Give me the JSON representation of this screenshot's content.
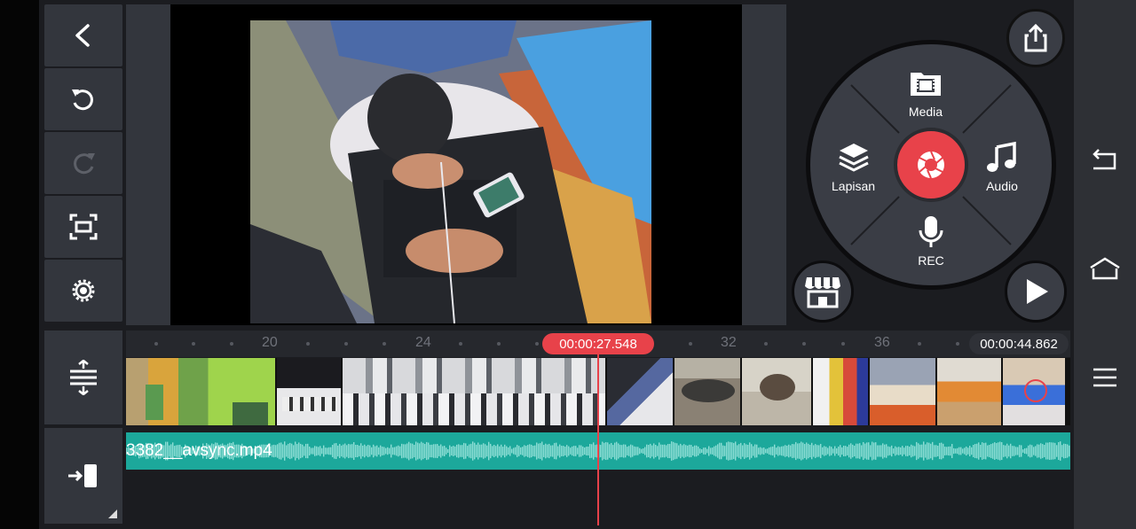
{
  "toolbar": {
    "back_icon": "chevron-left-icon",
    "undo_icon": "undo-icon",
    "redo_icon": "redo-icon",
    "capture_icon": "capture-frame-icon",
    "settings_icon": "gear-icon"
  },
  "wheel": {
    "media_label": "Media",
    "layer_label": "Lapisan",
    "audio_label": "Audio",
    "rec_label": "REC",
    "center_icon": "camera-shutter-icon"
  },
  "timeline": {
    "current_time": "00:00:27.548",
    "total_time": "00:00:44.862",
    "ruler_marks": [
      "20",
      "24",
      "32",
      "36"
    ],
    "audio_file": "3382__avsync.mp4"
  },
  "colors": {
    "accent": "#e8424a",
    "audio_track": "#1ca89b",
    "panel": "#33363d"
  }
}
